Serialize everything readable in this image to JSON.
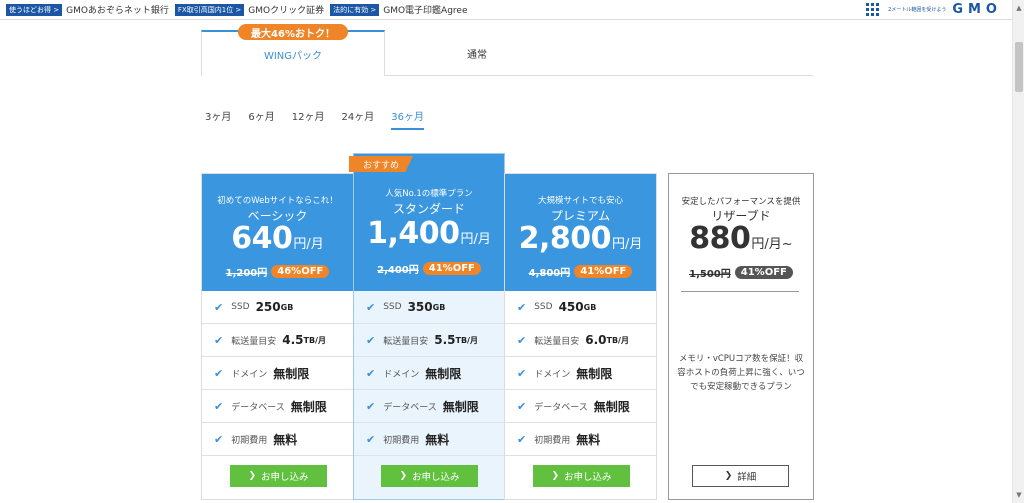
{
  "topbar": {
    "items": [
      {
        "badge": "使うほどお得 >",
        "text": "GMOあおぞらネット銀行"
      },
      {
        "badge": "FX取引高国内1位 >",
        "text": "GMOクリック証券"
      },
      {
        "badge": "法的に有効 >",
        "text": "GMO電子印鑑Agree"
      }
    ],
    "tagline": "2メートル範囲を受けよう",
    "logo": "GMO"
  },
  "tabs": {
    "promo": "最大46%おトク！",
    "wing": "WINGパック",
    "normal": "通常"
  },
  "periods": [
    "3ヶ月",
    "6ヶ月",
    "12ヶ月",
    "24ヶ月",
    "36ヶ月"
  ],
  "recommend_badge": "おすすめ",
  "plans": [
    {
      "tagline": "初めてのWebサイトならこれ！",
      "name": "ベーシック",
      "price": "640",
      "unit": "円/月",
      "old_price": "1,200円",
      "off": "46%OFF",
      "features": [
        {
          "label": "SSD",
          "value": "250",
          "unit": "GB"
        },
        {
          "label": "転送量目安",
          "value": "4.5",
          "unit": "TB/月"
        },
        {
          "label": "ドメイン",
          "value": "無制限",
          "unit": ""
        },
        {
          "label": "データベース",
          "value": "無制限",
          "unit": ""
        },
        {
          "label": "初期費用",
          "value": "無料",
          "unit": ""
        }
      ],
      "button": "お申し込み"
    },
    {
      "tagline": "人気No.1の標準プラン",
      "name": "スタンダード",
      "price": "1,400",
      "unit": "円/月",
      "old_price": "2,400円",
      "off": "41%OFF",
      "features": [
        {
          "label": "SSD",
          "value": "350",
          "unit": "GB"
        },
        {
          "label": "転送量目安",
          "value": "5.5",
          "unit": "TB/月"
        },
        {
          "label": "ドメイン",
          "value": "無制限",
          "unit": ""
        },
        {
          "label": "データベース",
          "value": "無制限",
          "unit": ""
        },
        {
          "label": "初期費用",
          "value": "無料",
          "unit": ""
        }
      ],
      "button": "お申し込み"
    },
    {
      "tagline": "大規模サイトでも安心",
      "name": "プレミアム",
      "price": "2,800",
      "unit": "円/月",
      "old_price": "4,800円",
      "off": "41%OFF",
      "features": [
        {
          "label": "SSD",
          "value": "450",
          "unit": "GB"
        },
        {
          "label": "転送量目安",
          "value": "6.0",
          "unit": "TB/月"
        },
        {
          "label": "ドメイン",
          "value": "無制限",
          "unit": ""
        },
        {
          "label": "データベース",
          "value": "無制限",
          "unit": ""
        },
        {
          "label": "初期費用",
          "value": "無料",
          "unit": ""
        }
      ],
      "button": "お申し込み"
    }
  ],
  "reserved": {
    "tagline": "安定したパフォーマンスを提供",
    "name": "リザーブド",
    "price": "880",
    "unit": "円/月~",
    "old_price": "1,500円",
    "off": "41%OFF",
    "description": "メモリ・vCPUコア数を保証！収容ホストの負荷上昇に強く、いつでも安定稼動できるプラン",
    "button": "詳細"
  },
  "colors": {
    "accent_blue": "#3a96df",
    "orange": "#f08527",
    "green": "#61c13f"
  }
}
